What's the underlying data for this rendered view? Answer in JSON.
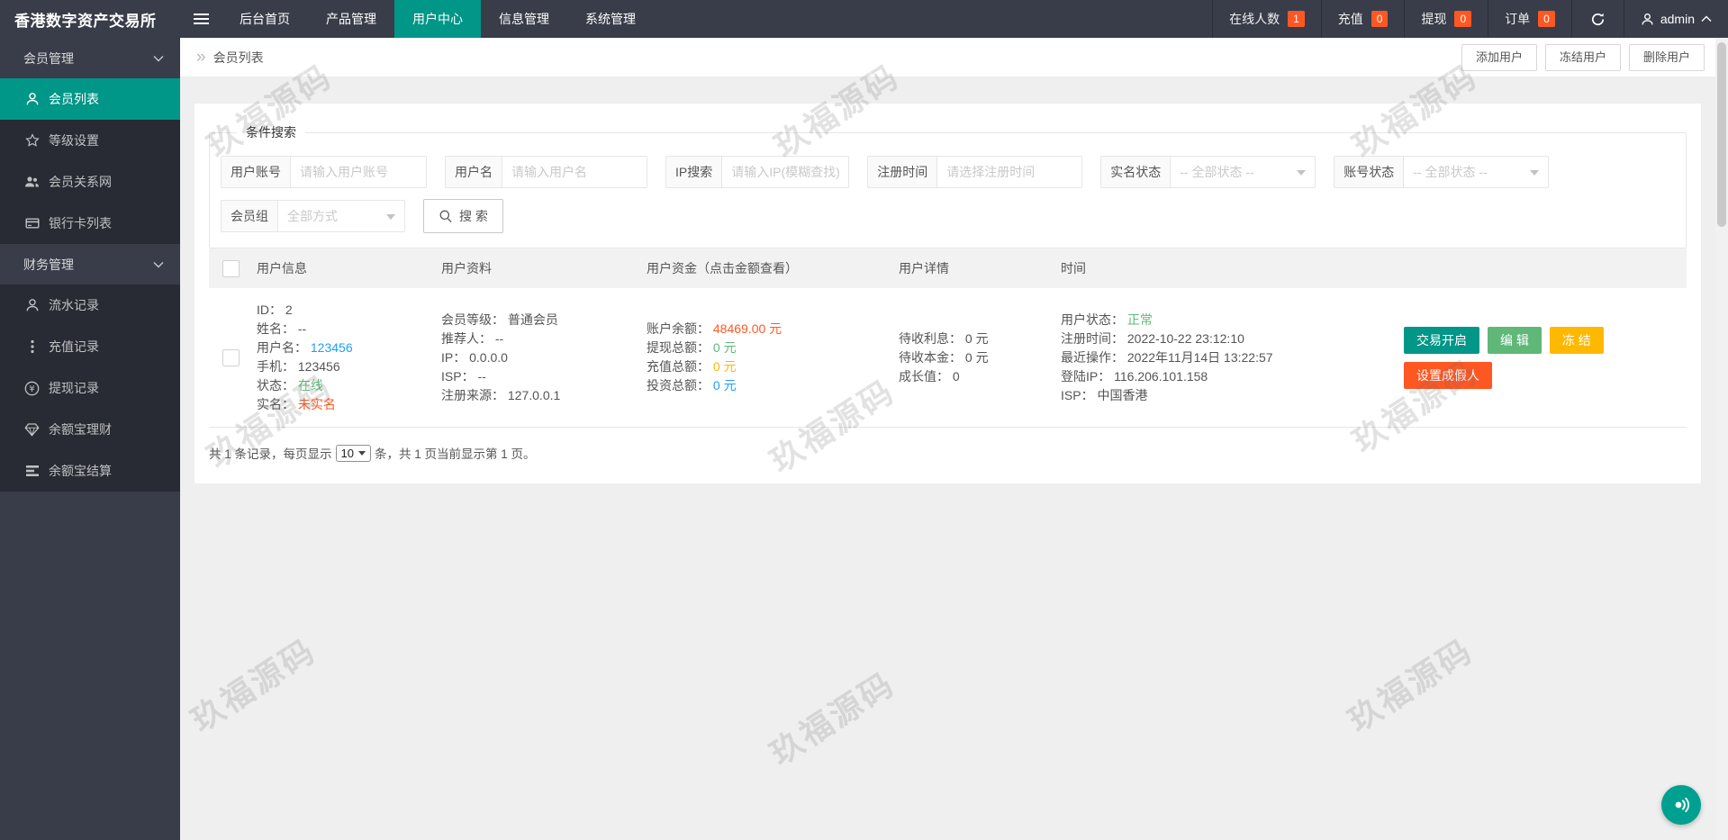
{
  "app": {
    "title": "香港数字资产交易所"
  },
  "topnav": {
    "items": [
      {
        "label": "后台首页",
        "active": false
      },
      {
        "label": "产品管理",
        "active": false
      },
      {
        "label": "用户中心",
        "active": true
      },
      {
        "label": "信息管理",
        "active": false
      },
      {
        "label": "系统管理",
        "active": false
      }
    ],
    "stats": [
      {
        "label": "在线人数",
        "count": "1"
      },
      {
        "label": "充值",
        "count": "0"
      },
      {
        "label": "提现",
        "count": "0"
      },
      {
        "label": "订单",
        "count": "0"
      }
    ],
    "user": {
      "name": "admin"
    }
  },
  "sidebar": {
    "sections": [
      {
        "title": "会员管理",
        "items": [
          {
            "label": "会员列表",
            "icon": "user-icon",
            "active": true
          },
          {
            "label": "等级设置",
            "icon": "star-icon",
            "active": false
          },
          {
            "label": "会员关系网",
            "icon": "group-icon",
            "active": false
          },
          {
            "label": "银行卡列表",
            "icon": "bank-card-icon",
            "active": false
          }
        ]
      },
      {
        "title": "财务管理",
        "items": [
          {
            "label": "流水记录",
            "icon": "user-icon",
            "active": false
          },
          {
            "label": "充值记录",
            "icon": "more-vertical-icon",
            "active": false
          },
          {
            "label": "提现记录",
            "icon": "rmb-icon",
            "active": false
          },
          {
            "label": "余额宝理财",
            "icon": "diamond-icon",
            "active": false
          },
          {
            "label": "余额宝结算",
            "icon": "list-icon",
            "active": false
          }
        ]
      }
    ]
  },
  "breadcrumb": {
    "arrow": "»",
    "label": "会员列表",
    "actions": [
      {
        "label": "添加用户"
      },
      {
        "label": "冻结用户"
      },
      {
        "label": "删除用户"
      }
    ]
  },
  "search": {
    "legend": "条件搜索",
    "fields": [
      {
        "label": "用户账号",
        "placeholder": "请输入用户账号"
      },
      {
        "label": "用户名",
        "placeholder": "请输入用户名"
      },
      {
        "label": "IP搜索",
        "placeholder": "请输入IP(模糊查找)"
      },
      {
        "label": "注册时间",
        "placeholder": "请选择注册时间"
      },
      {
        "label": "实名状态",
        "value": "-- 全部状态 --"
      },
      {
        "label": "账号状态",
        "value": "-- 全部状态 --"
      },
      {
        "label": "会员组",
        "value": "全部方式"
      }
    ],
    "search_button": "搜 索"
  },
  "table": {
    "columns": [
      "用户信息",
      "用户资料",
      "用户资金（点击金额查看）",
      "用户详情",
      "时间"
    ],
    "row": {
      "info": [
        {
          "label": "ID：",
          "value": "2"
        },
        {
          "label": "姓名：",
          "value": "--"
        },
        {
          "label": "用户名：",
          "value": "123456"
        },
        {
          "label": "手机：",
          "value": "123456"
        },
        {
          "label": "状态：",
          "value": "在线"
        },
        {
          "label": "实名：",
          "value": "未实名"
        }
      ],
      "profile": [
        {
          "label": "会员等级：",
          "value": "普通会员"
        },
        {
          "label": "推荐人：",
          "value": "--"
        },
        {
          "label": "IP：",
          "value": "0.0.0.0"
        },
        {
          "label": "ISP：",
          "value": "--"
        },
        {
          "label": "注册来源：",
          "value": "127.0.0.1"
        }
      ],
      "funds": [
        {
          "label": "账户余额：",
          "value": "48469.00 元"
        },
        {
          "label": "提现总额：",
          "value": "0 元"
        },
        {
          "label": "充值总额：",
          "value": "0 元"
        },
        {
          "label": "投资总额：",
          "value": "0 元"
        }
      ],
      "detail": [
        {
          "label": "待收利息：",
          "value": "0 元"
        },
        {
          "label": "待收本金：",
          "value": "0 元"
        },
        {
          "label": "成长值：",
          "value": "0"
        }
      ],
      "time": [
        {
          "label": "用户状态：",
          "value": "正常"
        },
        {
          "label": "注册时间：",
          "value": "2022-10-22 23:12:10"
        },
        {
          "label": "最近操作：",
          "value": "2022年11月14日 13:22:57"
        },
        {
          "label": "登陆IP：",
          "value": "116.206.101.158"
        },
        {
          "label": "ISP：",
          "value": "中国香港"
        }
      ],
      "actions": [
        {
          "label": "交易开启"
        },
        {
          "label": "编 辑"
        },
        {
          "label": "冻 结"
        },
        {
          "label": "设置成假人"
        }
      ]
    }
  },
  "pagination": {
    "prefix": "共 1 条记录，每页显示",
    "page_size": "10",
    "suffix": "条，共 1 页当前显示第 1 页。"
  },
  "watermark": {
    "text": "玖福源码"
  },
  "colors": {
    "topbar": "#393D49",
    "accent": "#009688",
    "badge": "#FF5722",
    "green": "#5FB878",
    "red": "#FF5722",
    "blue": "#1E9FFF",
    "yellow": "#FFB800"
  }
}
